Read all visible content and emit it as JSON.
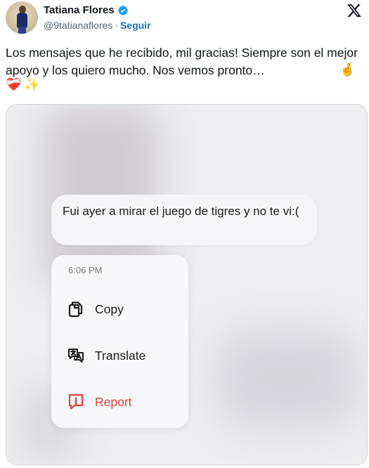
{
  "header": {
    "name": "Tatiana Flores",
    "handle": "@9tatianaflores",
    "separator": "·",
    "follow_label": "Seguir"
  },
  "tweet": {
    "text": "Los mensajes que he recibido, mil gracias! Siempre son el mejor apoyo y los quiero mucho. Nos vemos pronto…",
    "emojis": [
      "🤞",
      "❤️‍🩹",
      "✨"
    ]
  },
  "media": {
    "message": "Fui ayer a mirar el juego de tigres y no te vi:(",
    "menu": {
      "time": "6:06 PM",
      "items": [
        {
          "label": "Copy",
          "icon": "copy-icon"
        },
        {
          "label": "Translate",
          "icon": "translate-icon"
        },
        {
          "label": "Report",
          "icon": "report-icon"
        }
      ]
    }
  },
  "colors": {
    "accent": "#1d9bf0",
    "report": "#e0443a",
    "secondary_text": "#536471"
  }
}
